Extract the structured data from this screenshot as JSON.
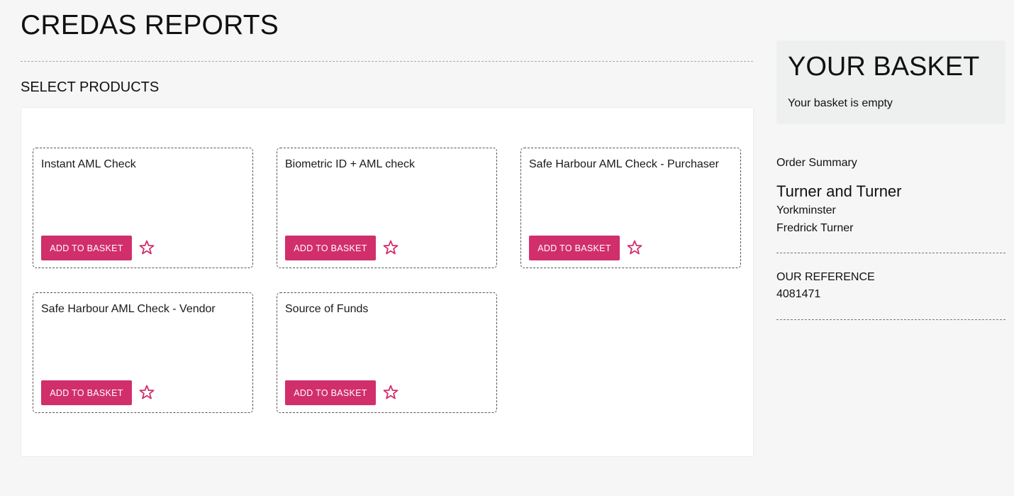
{
  "header": {
    "title": "CREDAS REPORTS"
  },
  "products_section": {
    "label": "SELECT PRODUCTS",
    "products": [
      {
        "name": "Instant AML Check",
        "button": "ADD TO BASKET"
      },
      {
        "name": "Biometric ID + AML check",
        "button": "ADD TO BASKET"
      },
      {
        "name": "Safe Harbour AML Check - Purchaser",
        "button": "ADD TO BASKET"
      },
      {
        "name": "Safe Harbour AML Check - Vendor",
        "button": "ADD TO BASKET"
      },
      {
        "name": "Source of Funds",
        "button": "ADD TO BASKET"
      }
    ]
  },
  "basket": {
    "title": "YOUR BASKET",
    "status": "Your basket is empty"
  },
  "order_summary": {
    "label": "Order Summary",
    "company": "Turner and Turner",
    "location": "Yorkminster",
    "contact": "Fredrick Turner"
  },
  "reference": {
    "label": "OUR REFERENCE",
    "value": "4081471"
  },
  "colors": {
    "accent": "#d12f6b",
    "basket_bg": "#eef0ef",
    "page_bg": "#f6f6f6"
  },
  "icons": {
    "favourite": "star-icon"
  }
}
